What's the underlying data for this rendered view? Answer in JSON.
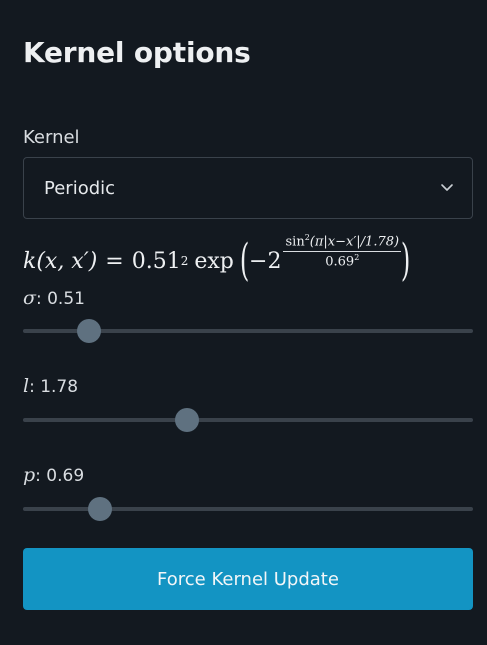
{
  "panel": {
    "title": "Kernel options"
  },
  "kernel": {
    "label": "Kernel",
    "selected": "Periodic",
    "icon": "chevron-down-icon"
  },
  "formula": {
    "lhs": "k(x, x′)",
    "equals": "=",
    "coef_base": "0.51",
    "coef_exp": "2",
    "func": "exp",
    "neg_coef": "−2",
    "numerator_func": "sin",
    "numerator_exp": "2",
    "numerator_arg": "(π|x−x′|/1.78)",
    "denominator_base": "0.69",
    "denominator_exp": "2"
  },
  "params": {
    "sigma": {
      "symbol": "σ",
      "value_text": ": 0.51",
      "value": 0.51,
      "min": 0,
      "max": 4
    },
    "l": {
      "symbol": "l",
      "value_text": ": 1.78",
      "value": 1.78,
      "min": 0,
      "max": 5
    },
    "p": {
      "symbol": "p",
      "value_text": ": 0.69",
      "value": 0.69,
      "min": 0,
      "max": 4.5
    }
  },
  "actions": {
    "force_update_label": "Force Kernel Update"
  },
  "colors": {
    "background": "#131920",
    "accent": "#1394c3",
    "slider_thumb": "#5f7180",
    "slider_track": "#3a424b"
  }
}
